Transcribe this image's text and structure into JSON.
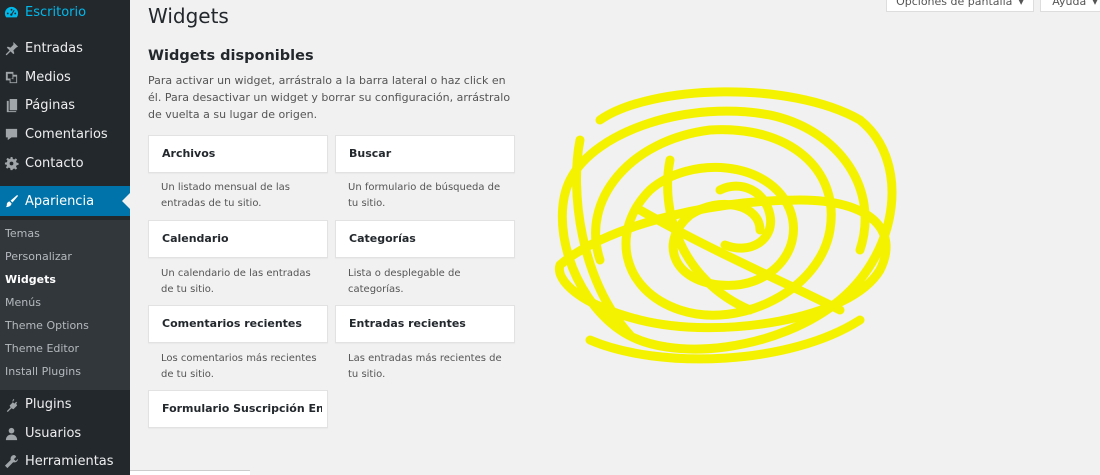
{
  "sidebar": {
    "top_item": {
      "label": "Escritorio",
      "icon": "dashboard-icon"
    },
    "items": [
      {
        "label": "Entradas",
        "icon": "pin-icon"
      },
      {
        "label": "Medios",
        "icon": "media-icon"
      },
      {
        "label": "Páginas",
        "icon": "pages-icon"
      },
      {
        "label": "Comentarios",
        "icon": "comment-icon"
      },
      {
        "label": "Contacto",
        "icon": "gear-icon"
      },
      {
        "label": "Apariencia",
        "icon": "brush-icon"
      }
    ],
    "submenu": [
      "Temas",
      "Personalizar",
      "Widgets",
      "Menús",
      "Theme Options",
      "Theme Editor",
      "Install Plugins"
    ],
    "submenu_active": "Widgets",
    "bottom_items": [
      {
        "label": "Plugins",
        "icon": "plugin-icon"
      },
      {
        "label": "Usuarios",
        "icon": "user-icon"
      },
      {
        "label": "Herramientas",
        "icon": "wrench-icon"
      }
    ]
  },
  "header": {
    "title": "Widgets",
    "screen_options": "Opciones de pantalla",
    "help": "Ayuda"
  },
  "available": {
    "title": "Widgets disponibles",
    "description": "Para activar un widget, arrástralo a la barra lateral o haz click en él. Para desactivar un widget y borrar su configuración, arrástralo de vuelta a su lugar de origen.",
    "widgets": [
      {
        "title": "Archivos",
        "description": "Un listado mensual de las entradas de tu sitio."
      },
      {
        "title": "Buscar",
        "description": "Un formulario de búsqueda de tu sitio."
      },
      {
        "title": "Calendario",
        "description": "Un calendario de las entradas de tu sitio."
      },
      {
        "title": "Categorías",
        "description": "Lista o desplegable de categorías."
      },
      {
        "title": "Comentarios recientes",
        "description": "Los comentarios más recientes de tu sitio."
      },
      {
        "title": "Entradas recientes",
        "description": "Las entradas más recientes de tu sitio."
      },
      {
        "title": "Formulario Suscripción Env...",
        "description": ""
      }
    ]
  },
  "colors": {
    "sidebar_bg": "#23282d",
    "accent": "#0073aa",
    "highlight_text": "#00b9eb",
    "scribble": "#f5f200"
  }
}
